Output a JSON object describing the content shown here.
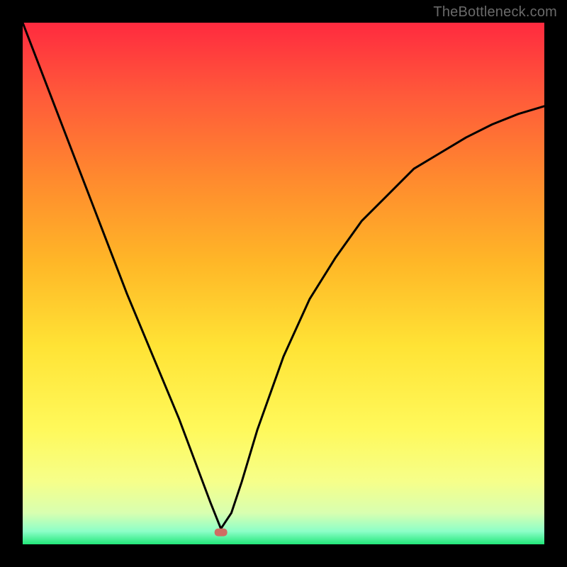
{
  "watermark": "TheBottleneck.com",
  "chart_data": {
    "type": "line",
    "title": "",
    "xlabel": "",
    "ylabel": "",
    "xlim": [
      0,
      100
    ],
    "ylim": [
      0,
      100
    ],
    "background_gradient_colors": [
      "#ff2a3f",
      "#ff5a3a",
      "#ff8a2e",
      "#ffb727",
      "#ffe335",
      "#fff95b",
      "#f6ff8a",
      "#d8ffb0",
      "#8dffc8",
      "#22e77a"
    ],
    "marker": {
      "x": 38,
      "y": 2.3,
      "color": "#cf6d63"
    },
    "series": [
      {
        "name": "curve",
        "x": [
          0,
          5,
          10,
          15,
          20,
          25,
          30,
          33,
          36,
          38,
          40,
          42,
          45,
          50,
          55,
          60,
          65,
          70,
          75,
          80,
          85,
          90,
          95,
          100
        ],
        "values": [
          100,
          87,
          74,
          61,
          48,
          36,
          24,
          16,
          8,
          3,
          6,
          12,
          22,
          36,
          47,
          55,
          62,
          67,
          72,
          75,
          78,
          80.5,
          82.5,
          84
        ]
      }
    ],
    "annotations": []
  }
}
